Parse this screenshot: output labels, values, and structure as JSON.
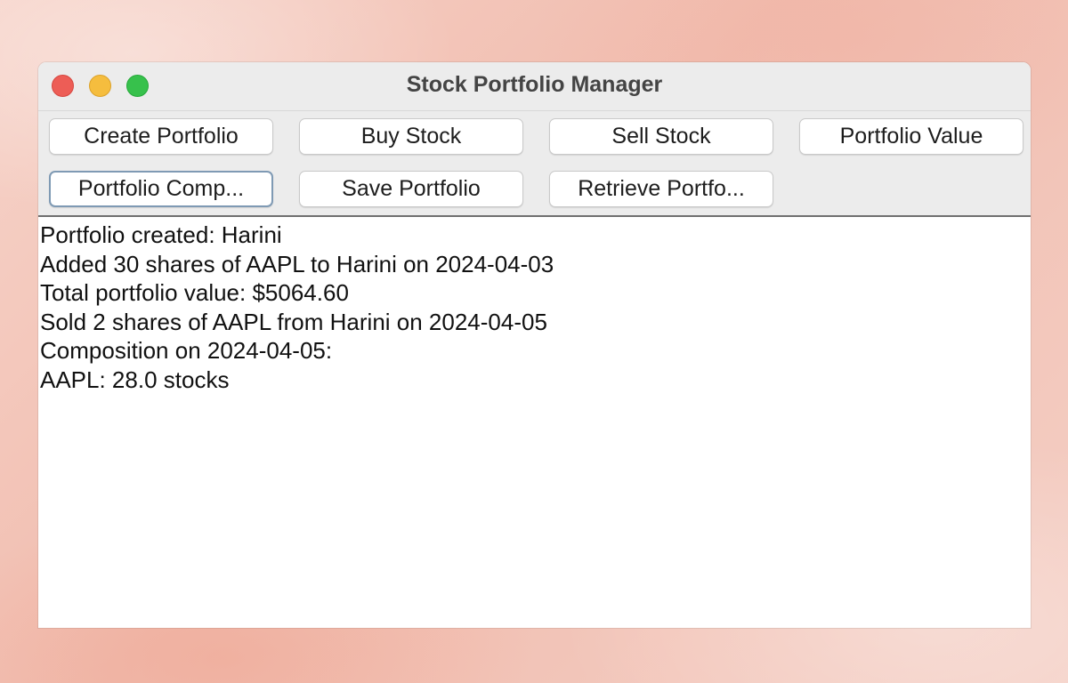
{
  "window": {
    "title": "Stock Portfolio Manager"
  },
  "toolbar": {
    "create_portfolio": "Create Portfolio",
    "buy_stock": "Buy Stock",
    "sell_stock": "Sell Stock",
    "portfolio_value": "Portfolio Value",
    "portfolio_composition": "Portfolio Comp...",
    "save_portfolio": "Save Portfolio",
    "retrieve_portfolio": "Retrieve Portfo..."
  },
  "output": {
    "lines": [
      "Portfolio created: Harini",
      "Added 30 shares of AAPL to Harini on 2024-04-03",
      "Total portfolio value: $5064.60",
      "Sold 2 shares of AAPL from Harini on 2024-04-05",
      "Composition on 2024-04-05:",
      "AAPL: 28.0 stocks"
    ]
  },
  "colors": {
    "close": "#ed5d56",
    "minimize": "#f5bd3e",
    "maximize": "#37c14c",
    "focus_ring": "#7f9ab4"
  }
}
